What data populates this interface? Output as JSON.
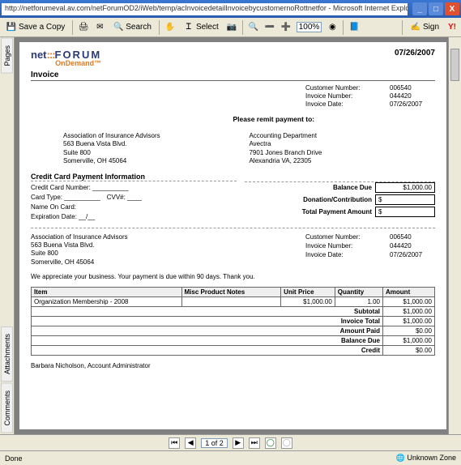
{
  "window": {
    "url": "http://netforumeval.av.com/netForumOD2/iWeb/temp/acInvoicedetailInvoicebycustomernoRottnetfor - Microsoft Internet Explorer",
    "min": "_",
    "max": "□",
    "close": "X"
  },
  "toolbar": {
    "save": "Save a Copy",
    "search": "Search",
    "select": "Select",
    "zoom": "100%",
    "sign": "Sign"
  },
  "sidetabs": {
    "pages": "Pages",
    "attachments": "Attachments",
    "comments": "Comments"
  },
  "invoice": {
    "date_top": "07/26/2007",
    "title": "Invoice",
    "cust_num_lbl": "Customer Number:",
    "cust_num": "006540",
    "inv_num_lbl": "Invoice Number:",
    "inv_num": "044420",
    "inv_date_lbl": "Invoice Date:",
    "inv_date": "07/26/2007",
    "remit_title": "Please remit payment to:",
    "billto": "Association of Insurance Advisors\n563 Buena Vista Blvd.\nSuite 800\nSomerville, OH 45064",
    "remit": "Accounting Department\nAvectra\n7901 Jones Branch Drive\nAlexandria VA, 22305"
  },
  "cc": {
    "title": "Credit Card Payment Information",
    "cardnum": "Credit Card Number: __________",
    "cardtype": "Card Type: __________",
    "cvv": "CVV#: ____",
    "name": "Name On Card:",
    "exp": "Expiration Date: __/__",
    "balance_lbl": "Balance Due",
    "balance": "$1,000.00",
    "donation_lbl": "Donation/Contribution",
    "donation": "$",
    "total_lbl": "Total Payment Amount",
    "total": "$"
  },
  "copy": {
    "addr": "Association of Insurance Advisors\n563 Buena Vista Blvd.\nSuite 800\nSomerville, OH 45064",
    "cust_num_lbl": "Customer Number:",
    "cust_num": "006540",
    "inv_num_lbl": "Invoice Number:",
    "inv_num": "044420",
    "inv_date_lbl": "Invoice Date:",
    "inv_date": "07/26/2007"
  },
  "thanks": "We appreciate your business. Your payment is due within 90 days. Thank you.",
  "items": {
    "headers": [
      "Item",
      "Misc Product Notes",
      "Unit Price",
      "Quantity",
      "Amount"
    ],
    "rows": [
      [
        "Organization Membership - 2008",
        "",
        "$1,000.00",
        "1.00",
        "$1,000.00"
      ]
    ],
    "totals": [
      {
        "label": "Subtotal",
        "value": "$1,000.00"
      },
      {
        "label": "Invoice Total",
        "value": "$1,000.00"
      },
      {
        "label": "Amount Paid",
        "value": "$0.00"
      },
      {
        "label": "Balance Due",
        "value": "$1,000.00"
      },
      {
        "label": "Credit",
        "value": "$0.00"
      }
    ]
  },
  "signer": "Barbara Nicholson, Account Administrator",
  "nav": {
    "page": "1 of 2"
  },
  "status": {
    "left": "Done",
    "right": "Unknown Zone"
  }
}
